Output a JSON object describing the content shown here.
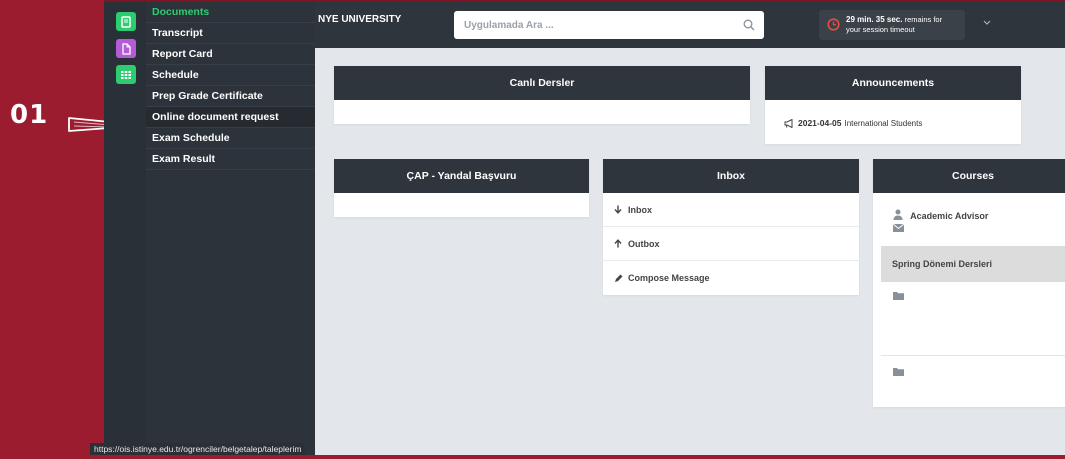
{
  "overlay": {
    "step_label": "01"
  },
  "sidebar": {
    "icons": [
      {
        "name": "book-icon",
        "color": "#2ecc71"
      },
      {
        "name": "document-icon",
        "color": "#b45bd6"
      },
      {
        "name": "grid-icon",
        "color": "#2ecc71"
      }
    ],
    "menu": [
      "Documents",
      "Transcript",
      "Report Card",
      "Schedule",
      "Prep Grade Certificate",
      "Online document request",
      "Exam Schedule",
      "Exam Result"
    ]
  },
  "topbar": {
    "brand": "NYE UNIVERSITY",
    "search_placeholder": "Uygulamada Ara ...",
    "session_time": "29 min. 35 sec.",
    "session_rest": "remains for",
    "session_line2": "your session timeout"
  },
  "panels": {
    "live": {
      "title": "Canlı Dersler"
    },
    "announcements": {
      "title": "Announcements",
      "date": "2021-04-05",
      "text": "International Students"
    },
    "cap": {
      "title": "ÇAP - Yandal Başvuru"
    },
    "inbox": {
      "title": "Inbox",
      "items": [
        "Inbox",
        "Outbox",
        "Compose Message"
      ]
    },
    "courses": {
      "title": "Courses",
      "advisor": "Academic Advisor",
      "term": "Spring Dönemi Dersleri"
    }
  },
  "status_bar": {
    "url": "https://ois.istinye.edu.tr/ogrenciler/belgetalep/taleplerim"
  },
  "colors": {
    "accent_green": "#2ecc71",
    "accent_purple": "#b45bd6",
    "panel_header": "#2f353d",
    "frame": "#9b1c2e"
  }
}
